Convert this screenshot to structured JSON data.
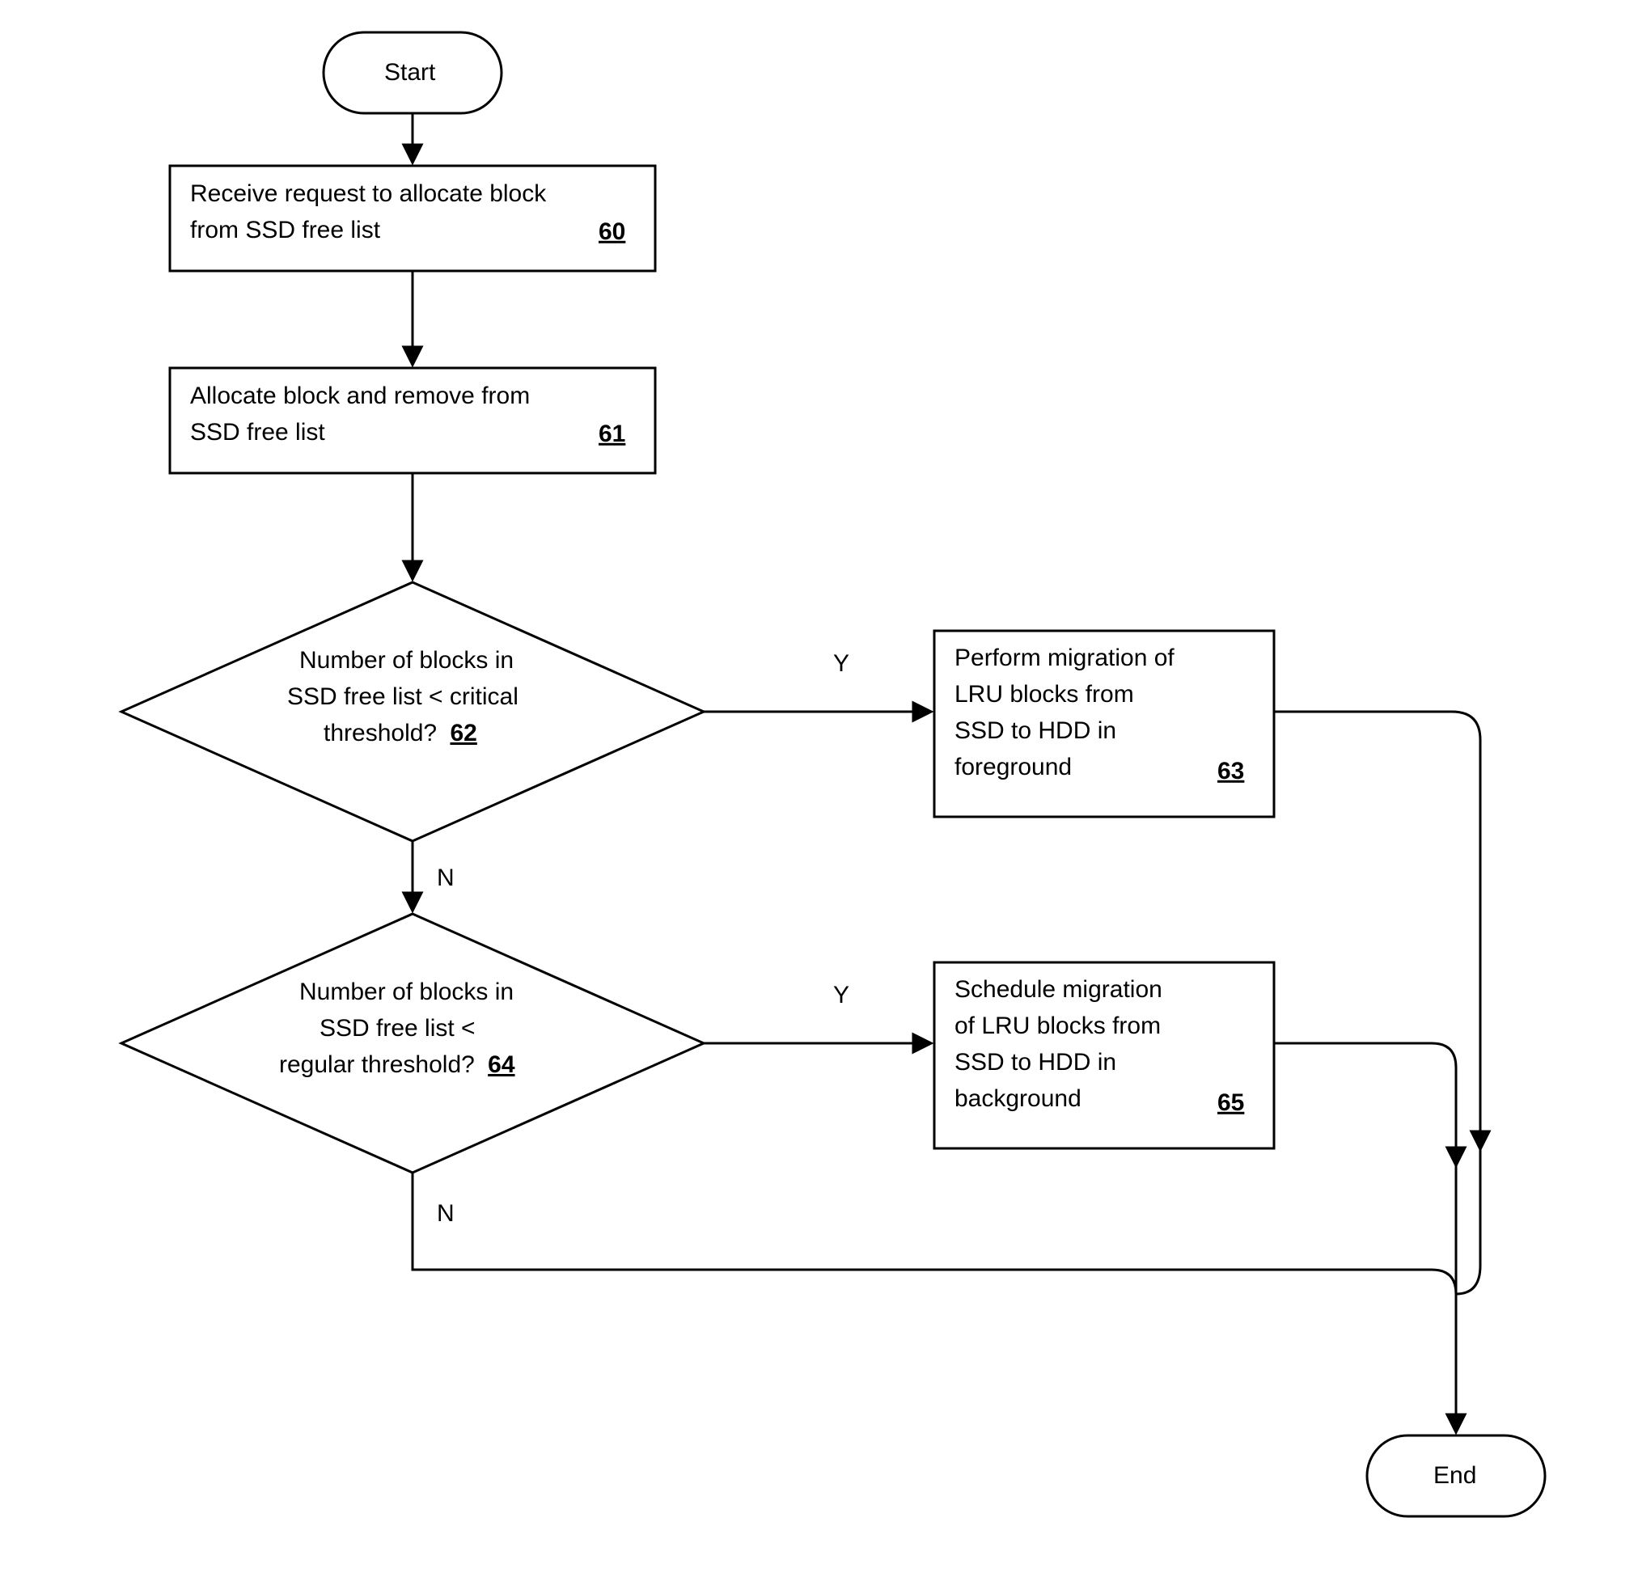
{
  "start": {
    "label": "Start"
  },
  "end": {
    "label": "End"
  },
  "step60": {
    "line1": "Receive request to allocate block",
    "line2": "from SSD free list",
    "ref": "60"
  },
  "step61": {
    "line1": "Allocate block and remove from",
    "line2": "SSD free list",
    "ref": "61"
  },
  "decision62": {
    "line1": "Number of blocks in",
    "line2": "SSD free list < critical",
    "line3": "threshold?",
    "ref": "62"
  },
  "step63": {
    "line1": "Perform migration of",
    "line2": "LRU blocks from",
    "line3": "SSD to HDD in",
    "line4": "foreground",
    "ref": "63"
  },
  "decision64": {
    "line1": "Number of blocks in",
    "line2": "SSD free list <",
    "line3": "regular threshold?",
    "ref": "64"
  },
  "step65": {
    "line1": "Schedule migration",
    "line2": "of LRU blocks from",
    "line3": "SSD to HDD in",
    "line4": "background",
    "ref": "65"
  },
  "labels": {
    "Y": "Y",
    "N": "N"
  }
}
